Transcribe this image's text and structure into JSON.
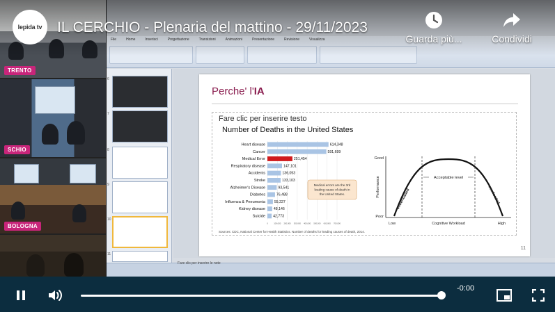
{
  "video": {
    "logo_text": "lepida tv",
    "title": "IL CERCHIO - Plenaria del mattino - 29/11/2023",
    "watch_later_label": "Guarda più...",
    "share_label": "Condividi",
    "time_remaining": "-0:00",
    "progress_fraction": 1.0
  },
  "cameras": [
    {
      "label": "TRENTO"
    },
    {
      "label": "SCHIO"
    },
    {
      "label": "BOLOGNA"
    }
  ],
  "slide": {
    "title_prefix": "Perche' l'",
    "title_emph": "IA",
    "placeholder": "Fare clic per inserire testo",
    "notes": "Fare clic per inserire le note",
    "number": "11",
    "source": "Sources: CDC, National Center for Health Statistics. Number of deaths for leading causes of death, 2014."
  },
  "chart_data": [
    {
      "type": "bar",
      "title": "Number of Deaths in the United States",
      "categories": [
        "Heart disease",
        "Cancer",
        "Medical Error",
        "Respiratory disease",
        "Accidents",
        "Stroke",
        "Alzheimer's Disease",
        "Diabetes",
        "Influenza & Pneumonia",
        "Kidney disease",
        "Suicide"
      ],
      "values": [
        614348,
        591699,
        251454,
        147101,
        136053,
        133103,
        93541,
        76488,
        55227,
        48146,
        42773
      ],
      "value_labels": [
        "614,348",
        "591,699",
        "251,454",
        "147,101",
        "136,053",
        "133,103",
        "93,541",
        "76,488",
        "55,227",
        "48,146",
        "42,773"
      ],
      "highlight": "Medical Error",
      "xlim": [
        0,
        700000
      ],
      "xticks": [
        "0",
        "100,000",
        "200,000",
        "300,000",
        "400,000",
        "500,000",
        "600,000",
        "700,000"
      ],
      "bar_color": "#a9c4e4",
      "highlight_color": "#d0191c",
      "annotation": "Medical errors are the 3rd leading cause of death in the United States.",
      "grid": true
    },
    {
      "type": "line",
      "xlabel": "Cognitive Workload",
      "ylabel": "Performance",
      "y_top": "Good",
      "y_bottom": "Poor",
      "x_left": "Low",
      "x_right": "High",
      "center_label": "Acceptable level",
      "left_zone": "underloaded",
      "right_zone": "overloaded"
    }
  ],
  "ppt": {
    "tabs": [
      "File",
      "Home",
      "Inserisci",
      "Progettazione",
      "Transizioni",
      "Animazioni",
      "Presentazione",
      "Revisione",
      "Visualizza"
    ]
  }
}
